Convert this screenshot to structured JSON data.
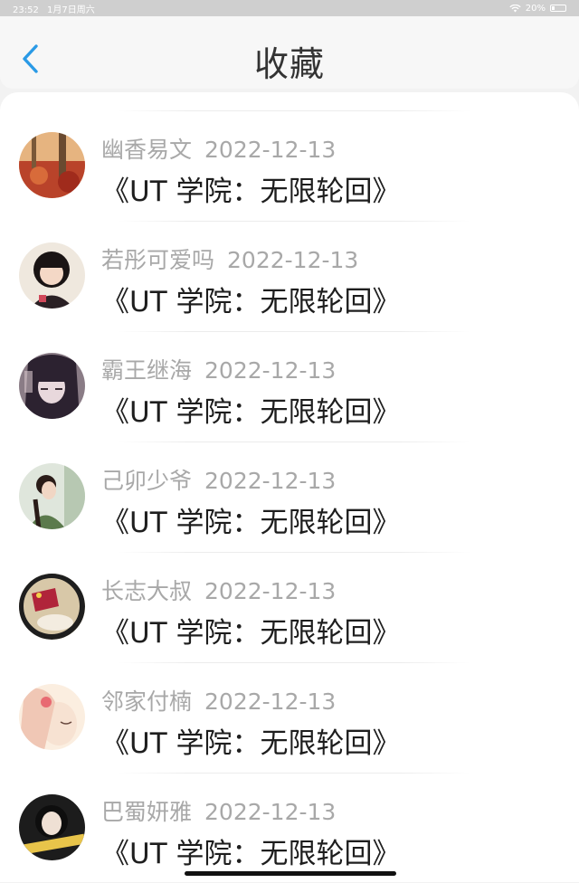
{
  "status_bar": {
    "time": "23:52",
    "date": "1月7日周六",
    "battery": "20%"
  },
  "header": {
    "title": "收藏"
  },
  "favorites": [
    {
      "user": "幽香易文",
      "date": "2022-12-13",
      "work": "《UT 学院：无限轮回》",
      "avatar_color": "#c0502d"
    },
    {
      "user": "若彤可爱吗",
      "date": "2022-12-13",
      "work": "《UT 学院：无限轮回》",
      "avatar_color": "#3a2a28"
    },
    {
      "user": "霸王继海",
      "date": "2022-12-13",
      "work": "《UT 学院：无限轮回》",
      "avatar_color": "#4a3b45"
    },
    {
      "user": "己卯少爷",
      "date": "2022-12-13",
      "work": "《UT 学院：无限轮回》",
      "avatar_color": "#6c8a62"
    },
    {
      "user": "长志大叔",
      "date": "2022-12-13",
      "work": "《UT 学院：无限轮回》",
      "avatar_color": "#b0243a"
    },
    {
      "user": "邻家付楠",
      "date": "2022-12-13",
      "work": "《UT 学院：无限轮回》",
      "avatar_color": "#f0c7b5"
    },
    {
      "user": "巴蜀妍雅",
      "date": "2022-12-13",
      "work": "《UT 学院：无限轮回》",
      "avatar_color": "#1c1c1c"
    }
  ],
  "colors": {
    "accent": "#2a9ae6",
    "meta_text": "#a8a8a8",
    "title_text": "#333333"
  }
}
